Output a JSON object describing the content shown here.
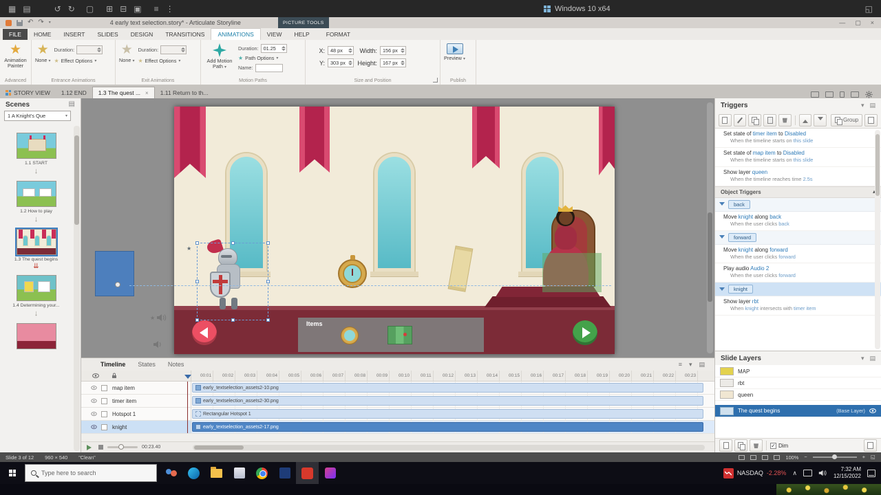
{
  "vm_bar": {
    "os_label": "Windows 10 x64"
  },
  "titlebar": {
    "title": "4 early text selection.story* - Articulate Storyline",
    "context_group": "PICTURE TOOLS"
  },
  "ribbon": {
    "tabs": [
      "FILE",
      "HOME",
      "INSERT",
      "SLIDES",
      "DESIGN",
      "TRANSITIONS",
      "ANIMATIONS",
      "VIEW",
      "HELP"
    ],
    "format_tab": "FORMAT",
    "advanced": {
      "button": "Animation Painter",
      "group_label": "Advanced"
    },
    "entrance": {
      "none": "None",
      "duration_label": "Duration:",
      "duration_value": "",
      "effect_options": "Effect Options",
      "group_label": "Entrance Animations"
    },
    "exit": {
      "none": "None",
      "duration_label": "Duration:",
      "duration_value": "",
      "effect_options": "Effect Options",
      "group_label": "Exit Animations"
    },
    "motion": {
      "button": "Add Motion Path",
      "duration_label": "Duration:",
      "duration_value": "01.25",
      "path_options": "Path Options",
      "name_label": "Name:",
      "group_label": "Motion Paths"
    },
    "size_position": {
      "x_label": "X:",
      "x_value": "48 px",
      "y_label": "Y:",
      "y_value": "303 px",
      "width_label": "Width:",
      "width_value": "156 px",
      "height_label": "Height:",
      "height_value": "167 px",
      "group_label": "Size and Position"
    },
    "publish": {
      "preview": "Preview",
      "group_label": "Publish"
    }
  },
  "doc_tabs": {
    "story_view": "STORY VIEW",
    "tab_end": "1.12 END",
    "tab_active": "1.3 The quest ...",
    "tab_return": "1.11 Return to th..."
  },
  "scenes": {
    "header": "Scenes",
    "scene_selector": "1 A Knight's Que",
    "captions": [
      "1.1 START",
      "1.2 How to play",
      "1.3 The quest begins",
      "1.4 Determining your..."
    ]
  },
  "stage": {
    "items_bar_label": "Items"
  },
  "triggers": {
    "header": "Triggers",
    "group_button": "Group",
    "object_triggers_header": "Object Triggers",
    "slide_triggers": [
      {
        "action": [
          {
            "t": "Set state of "
          },
          {
            "t": "timer item",
            "link": true
          },
          {
            "t": " to "
          },
          {
            "t": "Disabled",
            "link": true
          }
        ],
        "condition": [
          {
            "t": "When the timeline starts on "
          },
          {
            "t": "this slide",
            "link": true
          }
        ]
      },
      {
        "action": [
          {
            "t": "Set state of "
          },
          {
            "t": "map item",
            "link": true
          },
          {
            "t": " to "
          },
          {
            "t": "Disabled",
            "link": true
          }
        ],
        "condition": [
          {
            "t": "When the timeline starts on "
          },
          {
            "t": "this slide",
            "link": true
          }
        ]
      },
      {
        "action": [
          {
            "t": "Show layer "
          },
          {
            "t": "queen",
            "link": true
          }
        ],
        "condition": [
          {
            "t": "When the timeline reaches time "
          },
          {
            "t": "2.5s",
            "link": true
          }
        ]
      }
    ],
    "sections": [
      {
        "name": "back",
        "triggers": [
          {
            "action": [
              {
                "t": "Move "
              },
              {
                "t": "knight",
                "link": true
              },
              {
                "t": " along "
              },
              {
                "t": "back",
                "link": true
              }
            ],
            "condition": [
              {
                "t": "When the user clicks "
              },
              {
                "t": "back",
                "link": true
              }
            ]
          }
        ]
      },
      {
        "name": "forward",
        "triggers": [
          {
            "action": [
              {
                "t": "Move "
              },
              {
                "t": "knight",
                "link": true
              },
              {
                "t": " along "
              },
              {
                "t": "forward",
                "link": true
              }
            ],
            "condition": [
              {
                "t": "When the user clicks "
              },
              {
                "t": "forward",
                "link": true
              }
            ]
          },
          {
            "action": [
              {
                "t": "Play audio "
              },
              {
                "t": "Audio 2",
                "link": true
              }
            ],
            "condition": [
              {
                "t": "When the user clicks "
              },
              {
                "t": "forward",
                "link": true
              }
            ]
          }
        ]
      },
      {
        "name": "knight",
        "triggers": [
          {
            "action": [
              {
                "t": "Show layer "
              },
              {
                "t": "rbt",
                "link": true
              }
            ],
            "condition": [
              {
                "t": "When "
              },
              {
                "t": "knight",
                "link": true
              },
              {
                "t": " intersects with "
              },
              {
                "t": "timer item",
                "link": true
              }
            ]
          }
        ]
      }
    ]
  },
  "slide_layers": {
    "header": "Slide Layers",
    "layers": [
      "MAP",
      "rbt",
      "queen"
    ],
    "base_layer": {
      "name": "The quest begins",
      "badge": "(Base Layer)"
    },
    "dim_label": "Dim"
  },
  "timeline": {
    "tabs": [
      "Timeline",
      "States",
      "Notes"
    ],
    "ruler": [
      "00:01",
      "00:02",
      "00:03",
      "00:04",
      "00:05",
      "00:06",
      "00:07",
      "00:08",
      "00:09",
      "00:10",
      "00:11",
      "00:12",
      "00:13",
      "00:14",
      "00:15",
      "00:16",
      "00:17",
      "00:18",
      "00:19",
      "00:20",
      "00:21",
      "00:22",
      "00:23"
    ],
    "rows": [
      {
        "name": "map item",
        "bar": "early_textselection_assets2-10.png"
      },
      {
        "name": "timer item",
        "bar": "early_textselection_assets2-30.png"
      },
      {
        "name": "Hotspot 1",
        "bar": "Rectangular Hotspot 1"
      },
      {
        "name": "knight",
        "bar": "early_textselection_assets2-17.png"
      }
    ],
    "time_display": "00:23.40"
  },
  "statusbar": {
    "slide_info": "Slide 3 of 12",
    "dimensions": "960 × 540",
    "theme": "\"Clean\"",
    "zoom": "100%"
  },
  "taskbar": {
    "search_placeholder": "Type here to search",
    "stock_symbol": "NASDAQ",
    "stock_change": "-2.28%",
    "time": "7:32 AM",
    "date": "12/15/2022"
  }
}
